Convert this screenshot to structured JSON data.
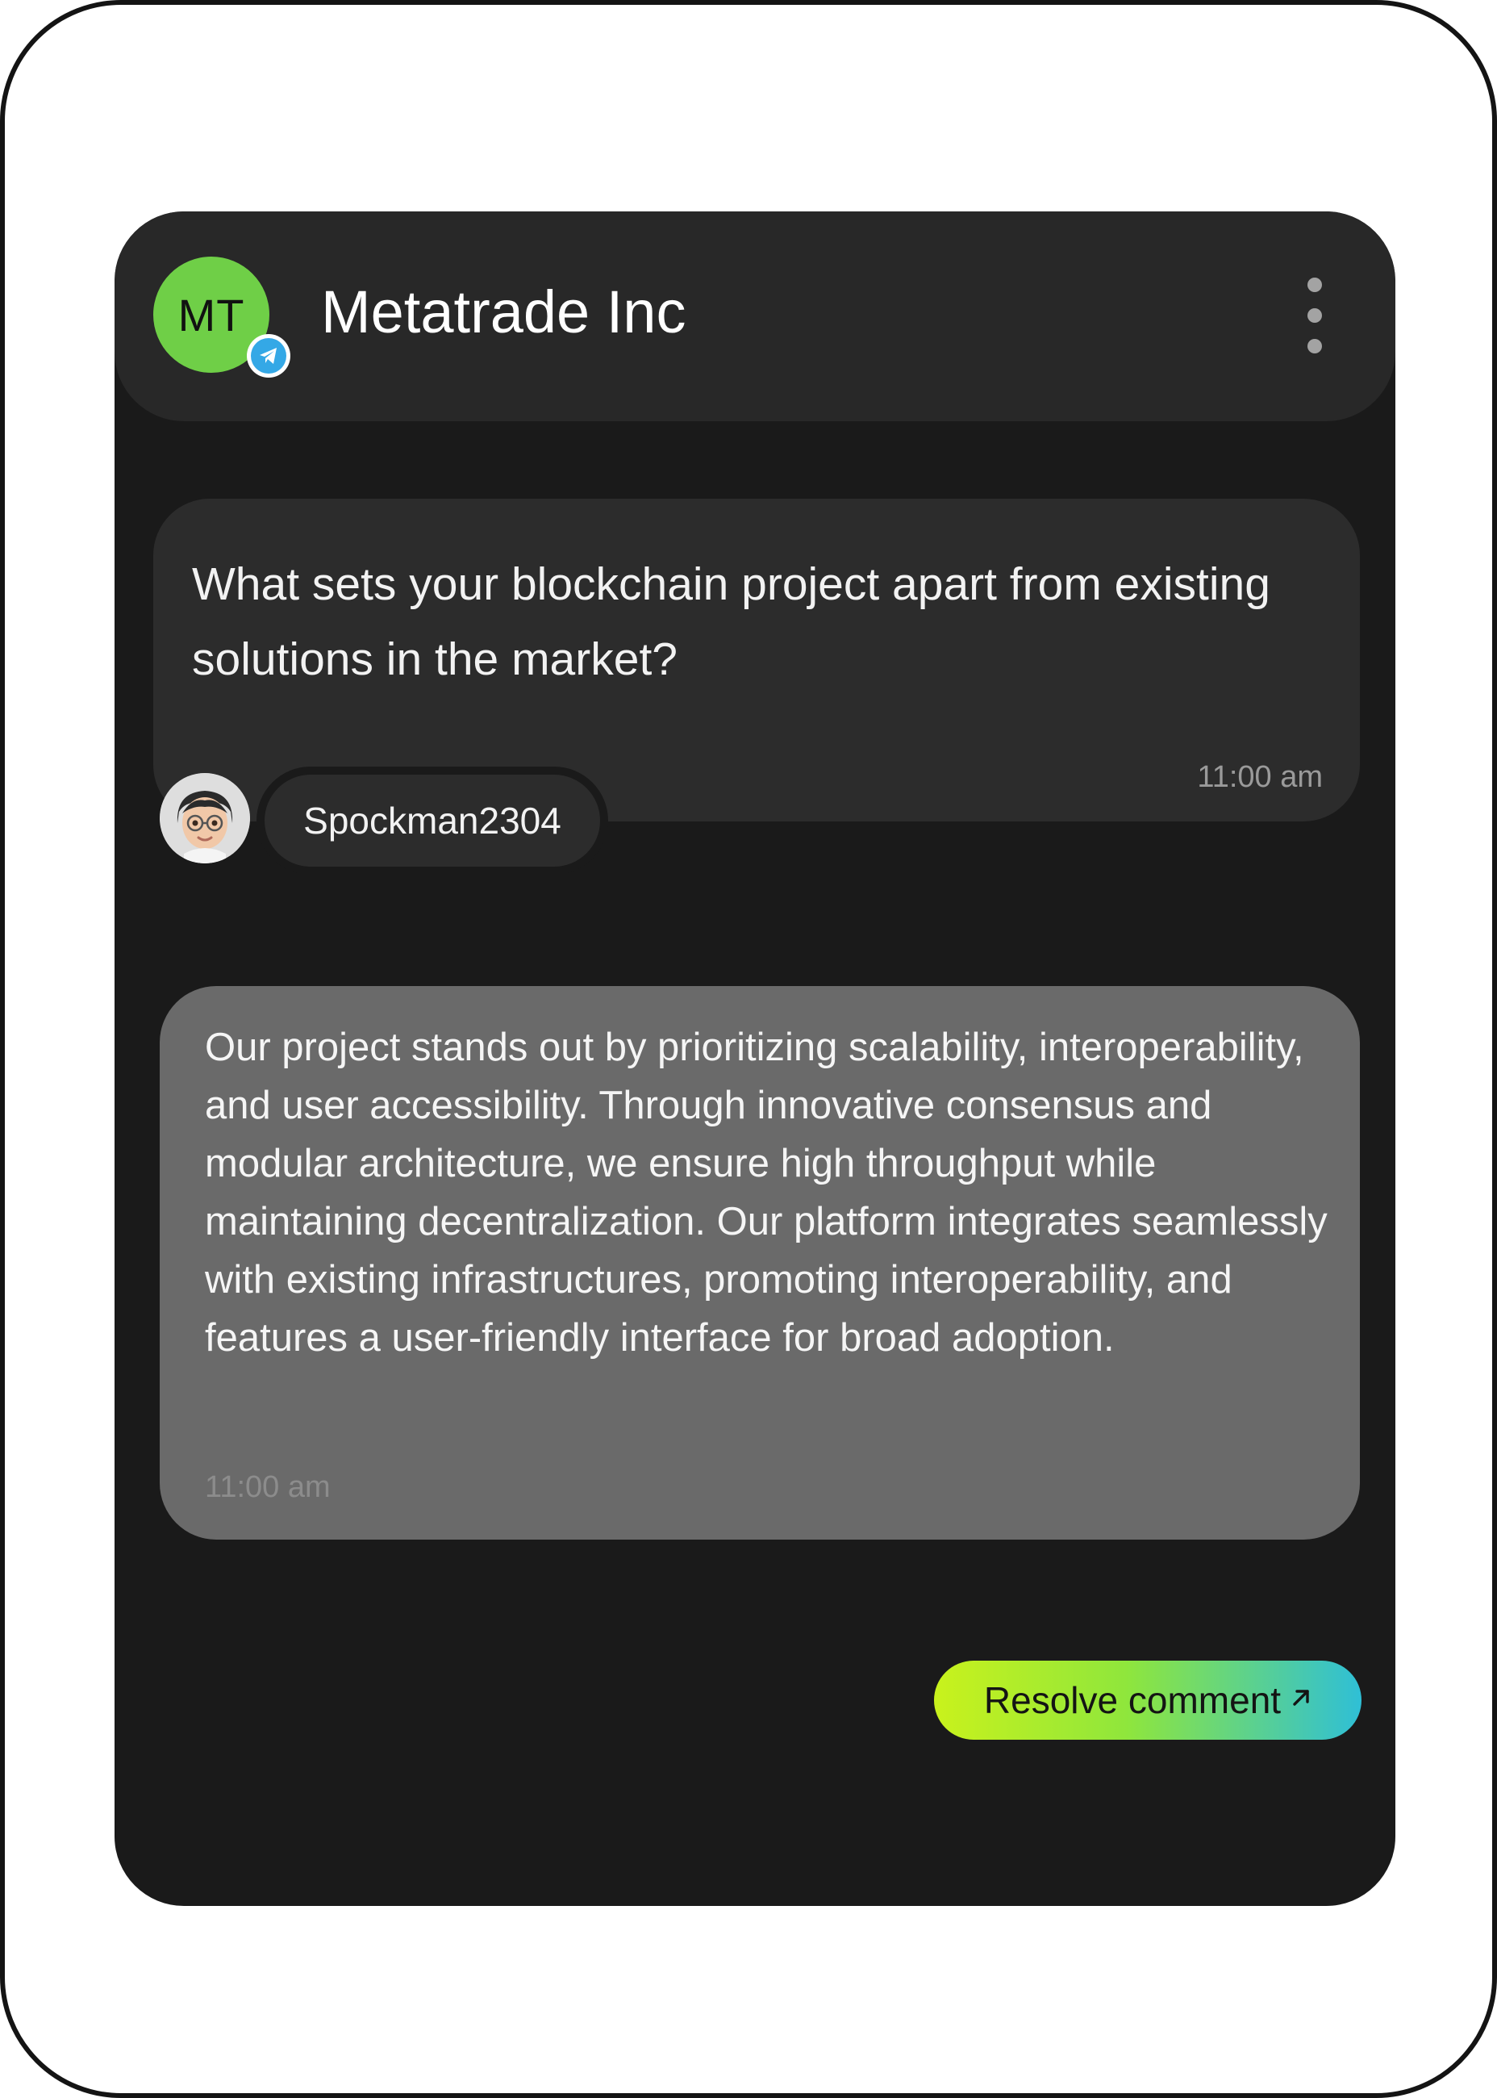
{
  "header": {
    "avatar_initials": "MT",
    "avatar_color": "#6fcf47",
    "badge_icon": "telegram-icon",
    "badge_color": "#34a8e6",
    "title": "Metatrade Inc",
    "menu_icon": "more-vertical-icon"
  },
  "question": {
    "text": "What sets your blockchain project apart from existing solutions in the market?",
    "time": "11:00 am",
    "author": {
      "name": "Spockman2304",
      "avatar_icon": "memoji-avatar"
    }
  },
  "answer": {
    "text": "Our project stands out by prioritizing scalability, interoperability, and user accessibility. Through innovative consensus and modular architecture, we ensure high throughput while maintaining decentralization. Our platform integrates seamlessly with existing infrastructures, promoting interoperability, and features a user-friendly interface for broad adoption.",
    "time": "11:00 am"
  },
  "actions": {
    "resolve_label": "Resolve comment",
    "resolve_icon": "arrow-up-right-icon",
    "resolve_gradient": [
      "#c9f21c",
      "#8fe63c",
      "#2fbfd6"
    ]
  }
}
